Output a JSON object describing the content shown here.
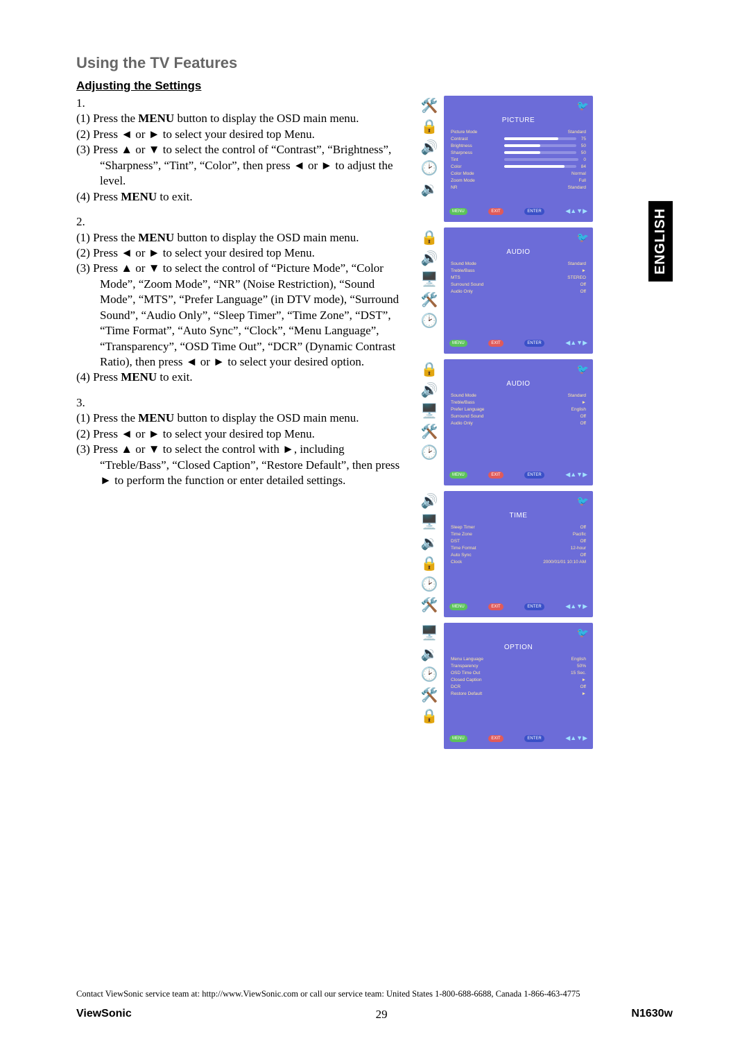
{
  "lang_tab": "ENGLISH",
  "section_title": "Using the TV Features",
  "subsection_title": "Adjusting the Settings",
  "arrows": {
    "left": "◄",
    "right": "►",
    "up": "▲",
    "down": "▼"
  },
  "steps": [
    {
      "num": "1.",
      "subs": [
        "(1) Press the MENU button to display the OSD main menu.",
        "(2) Press ◄ or ► to select your desired top Menu.",
        "(3) Press ▲ or ▼ to select the control of “Contrast”, “Brightness”, “Sharpness”, “Tint”, “Color”, then press ◄ or ► to adjust the level.",
        "(4) Press MENU to exit."
      ]
    },
    {
      "num": "2.",
      "subs": [
        "(1) Press the MENU button to display the OSD main menu.",
        "(2) Press ◄ or ► to select your desired top Menu.",
        "(3) Press ▲ or ▼ to select the control of “Picture Mode”, “Color Mode”, “Zoom Mode”, “NR” (Noise Restriction), “Sound Mode”, “MTS”, “Prefer Language” (in DTV mode), “Surround Sound”, “Audio Only”, “Sleep Timer”, “Time Zone”, “DST”, “Time Format”, “Auto Sync”, “Clock”, “Menu Language”, “Transparency”, “OSD Time Out”, “DCR” (Dynamic Contrast Ratio), then press ◄ or ► to select your desired option.",
        "(4) Press MENU to exit."
      ]
    },
    {
      "num": "3.",
      "subs": [
        "(1) Press the MENU button to display the OSD main menu.",
        "(2) Press ◄ or ► to select your desired top Menu.",
        "(3) Press ▲ or ▼ to select the control with ►, including “Treble/Bass”, “Closed Caption”, “Restore Default”, then press ► to perform the function or enter detailed settings."
      ]
    }
  ],
  "osd_footer": {
    "menu": "MENU",
    "exit": "EXIT",
    "enter": "ENTER"
  },
  "panels": [
    {
      "title": "PICTURE",
      "icons": [
        "wrench",
        "lock",
        "speaker",
        "clock",
        "speaker2"
      ],
      "rows": [
        {
          "label": "Picture Mode",
          "value": "Standard"
        },
        {
          "label": "Contrast",
          "bar": 75,
          "value": "75"
        },
        {
          "label": "Brightness",
          "bar": 50,
          "value": "50"
        },
        {
          "label": "Sharpness",
          "bar": 50,
          "value": "50"
        },
        {
          "label": "Tint",
          "bar": 0,
          "value": "0"
        },
        {
          "label": "Color",
          "bar": 84,
          "value": "84"
        },
        {
          "label": "Color Mode",
          "value": "Normal"
        },
        {
          "label": "Zoom Mode",
          "value": "Full"
        },
        {
          "label": "NR",
          "value": "Standard"
        }
      ]
    },
    {
      "title": "AUDIO",
      "icons": [
        "lock",
        "speaker",
        "tv",
        "wrench",
        "clock"
      ],
      "rows": [
        {
          "label": "Sound Mode",
          "value": "Standard"
        },
        {
          "label": "Treble/Bass",
          "value": "►"
        },
        {
          "label": "MTS",
          "value": "STEREO"
        },
        {
          "label": "Surround Sound",
          "value": "Off"
        },
        {
          "label": "Audio Only",
          "value": "Off"
        }
      ]
    },
    {
      "title": "AUDIO",
      "icons": [
        "lock",
        "speaker",
        "tv",
        "wrench",
        "clock"
      ],
      "rows": [
        {
          "label": "Sound Mode",
          "value": "Standard"
        },
        {
          "label": "Treble/Bass",
          "value": "►"
        },
        {
          "label": "Prefer Language",
          "value": "English"
        },
        {
          "label": "Surround Sound",
          "value": "Off"
        },
        {
          "label": "Audio Only",
          "value": "Off"
        }
      ]
    },
    {
      "title": "TIME",
      "icons": [
        "speaker",
        "tv",
        "speaker2",
        "lock",
        "clock",
        "wrench"
      ],
      "rows": [
        {
          "label": "Sleep Timer",
          "value": "Off"
        },
        {
          "label": "Time Zone",
          "value": "Pacific"
        },
        {
          "label": "DST",
          "value": "Off"
        },
        {
          "label": "Time Format",
          "value": "12-hour"
        },
        {
          "label": "Auto Sync",
          "value": "Off"
        },
        {
          "label": "Clock",
          "value": "2000/01/01 10:10 AM"
        }
      ]
    },
    {
      "title": "OPTION",
      "icons": [
        "tv",
        "speaker2",
        "clock",
        "wrench",
        "lock"
      ],
      "rows": [
        {
          "label": "Menu Language",
          "value": "English"
        },
        {
          "label": "Transparency",
          "value": "50%"
        },
        {
          "label": "OSD Time Out",
          "value": "15 Sec."
        },
        {
          "label": "Closed Caption",
          "value": "►"
        },
        {
          "label": "DCR",
          "value": "Off"
        },
        {
          "label": "Restore Default",
          "value": "►"
        }
      ]
    }
  ],
  "contact": "Contact ViewSonic service team at: http://www.ViewSonic.com or call our service team: United States 1-800-688-6688, Canada 1-866-463-4775",
  "footer": {
    "brand": "ViewSonic",
    "page": "29",
    "model": "N1630w"
  }
}
